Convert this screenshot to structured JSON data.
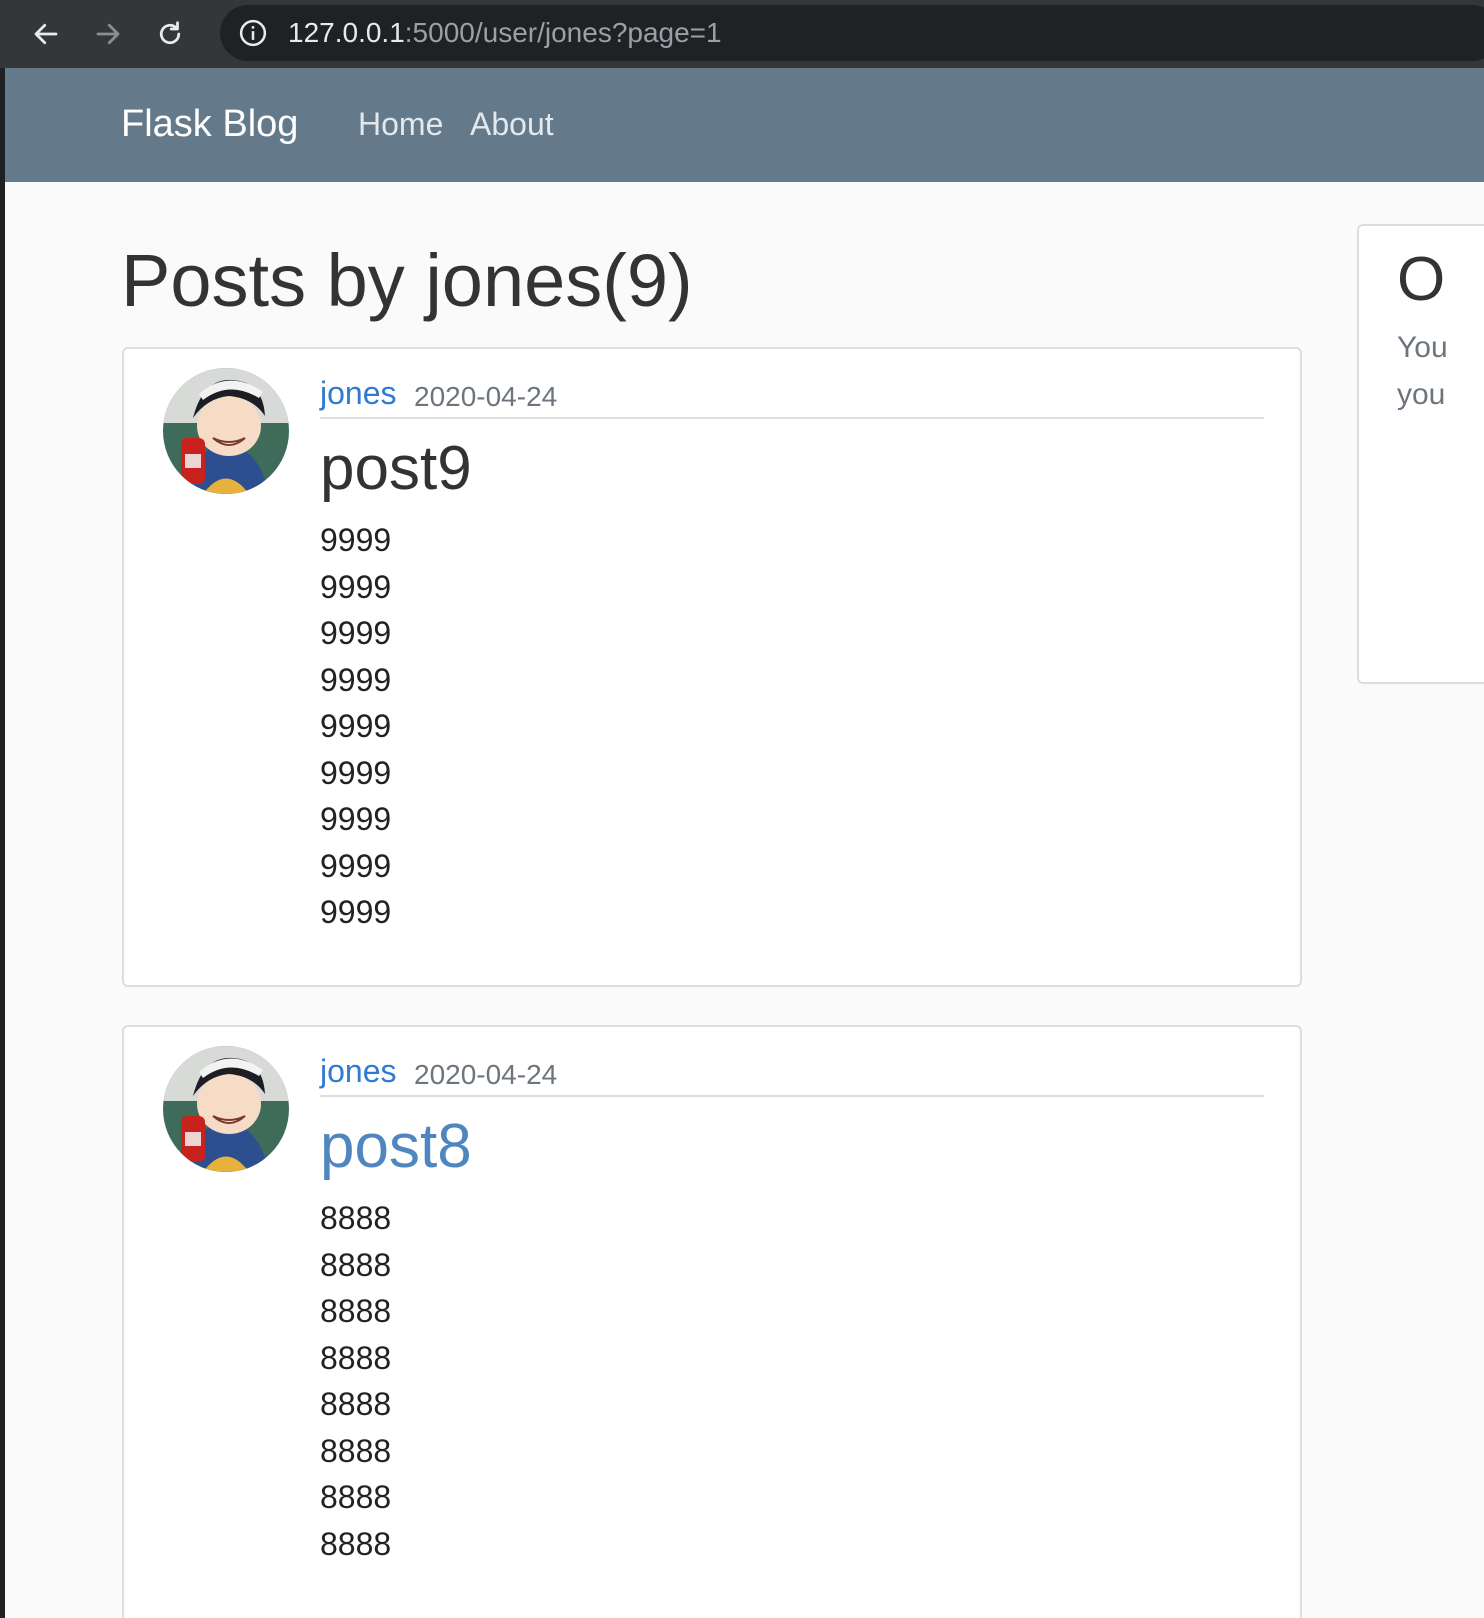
{
  "browser": {
    "url_host": "127.0.0.1",
    "url_rest": ":5000/user/jones?page=1",
    "back_icon": "arrow-left-icon",
    "forward_icon": "arrow-right-icon",
    "reload_icon": "reload-icon",
    "info_icon": "info-icon"
  },
  "navbar": {
    "brand": "Flask Blog",
    "links": [
      "Home",
      "About"
    ],
    "color": "#64798a"
  },
  "main": {
    "title": "Posts by jones(9)",
    "posts": [
      {
        "author": "jones",
        "date": "2020-04-24",
        "title": "post9",
        "lines": [
          "9999",
          "9999",
          "9999",
          "9999",
          "9999",
          "9999",
          "9999",
          "9999",
          "9999"
        ]
      },
      {
        "author": "jones",
        "date": "2020-04-24",
        "title": "post8",
        "lines": [
          "8888",
          "8888",
          "8888",
          "8888",
          "8888",
          "8888",
          "8888",
          "8888"
        ]
      }
    ]
  },
  "sidebar": {
    "title": "O",
    "text_lines": [
      "You",
      "you"
    ]
  }
}
